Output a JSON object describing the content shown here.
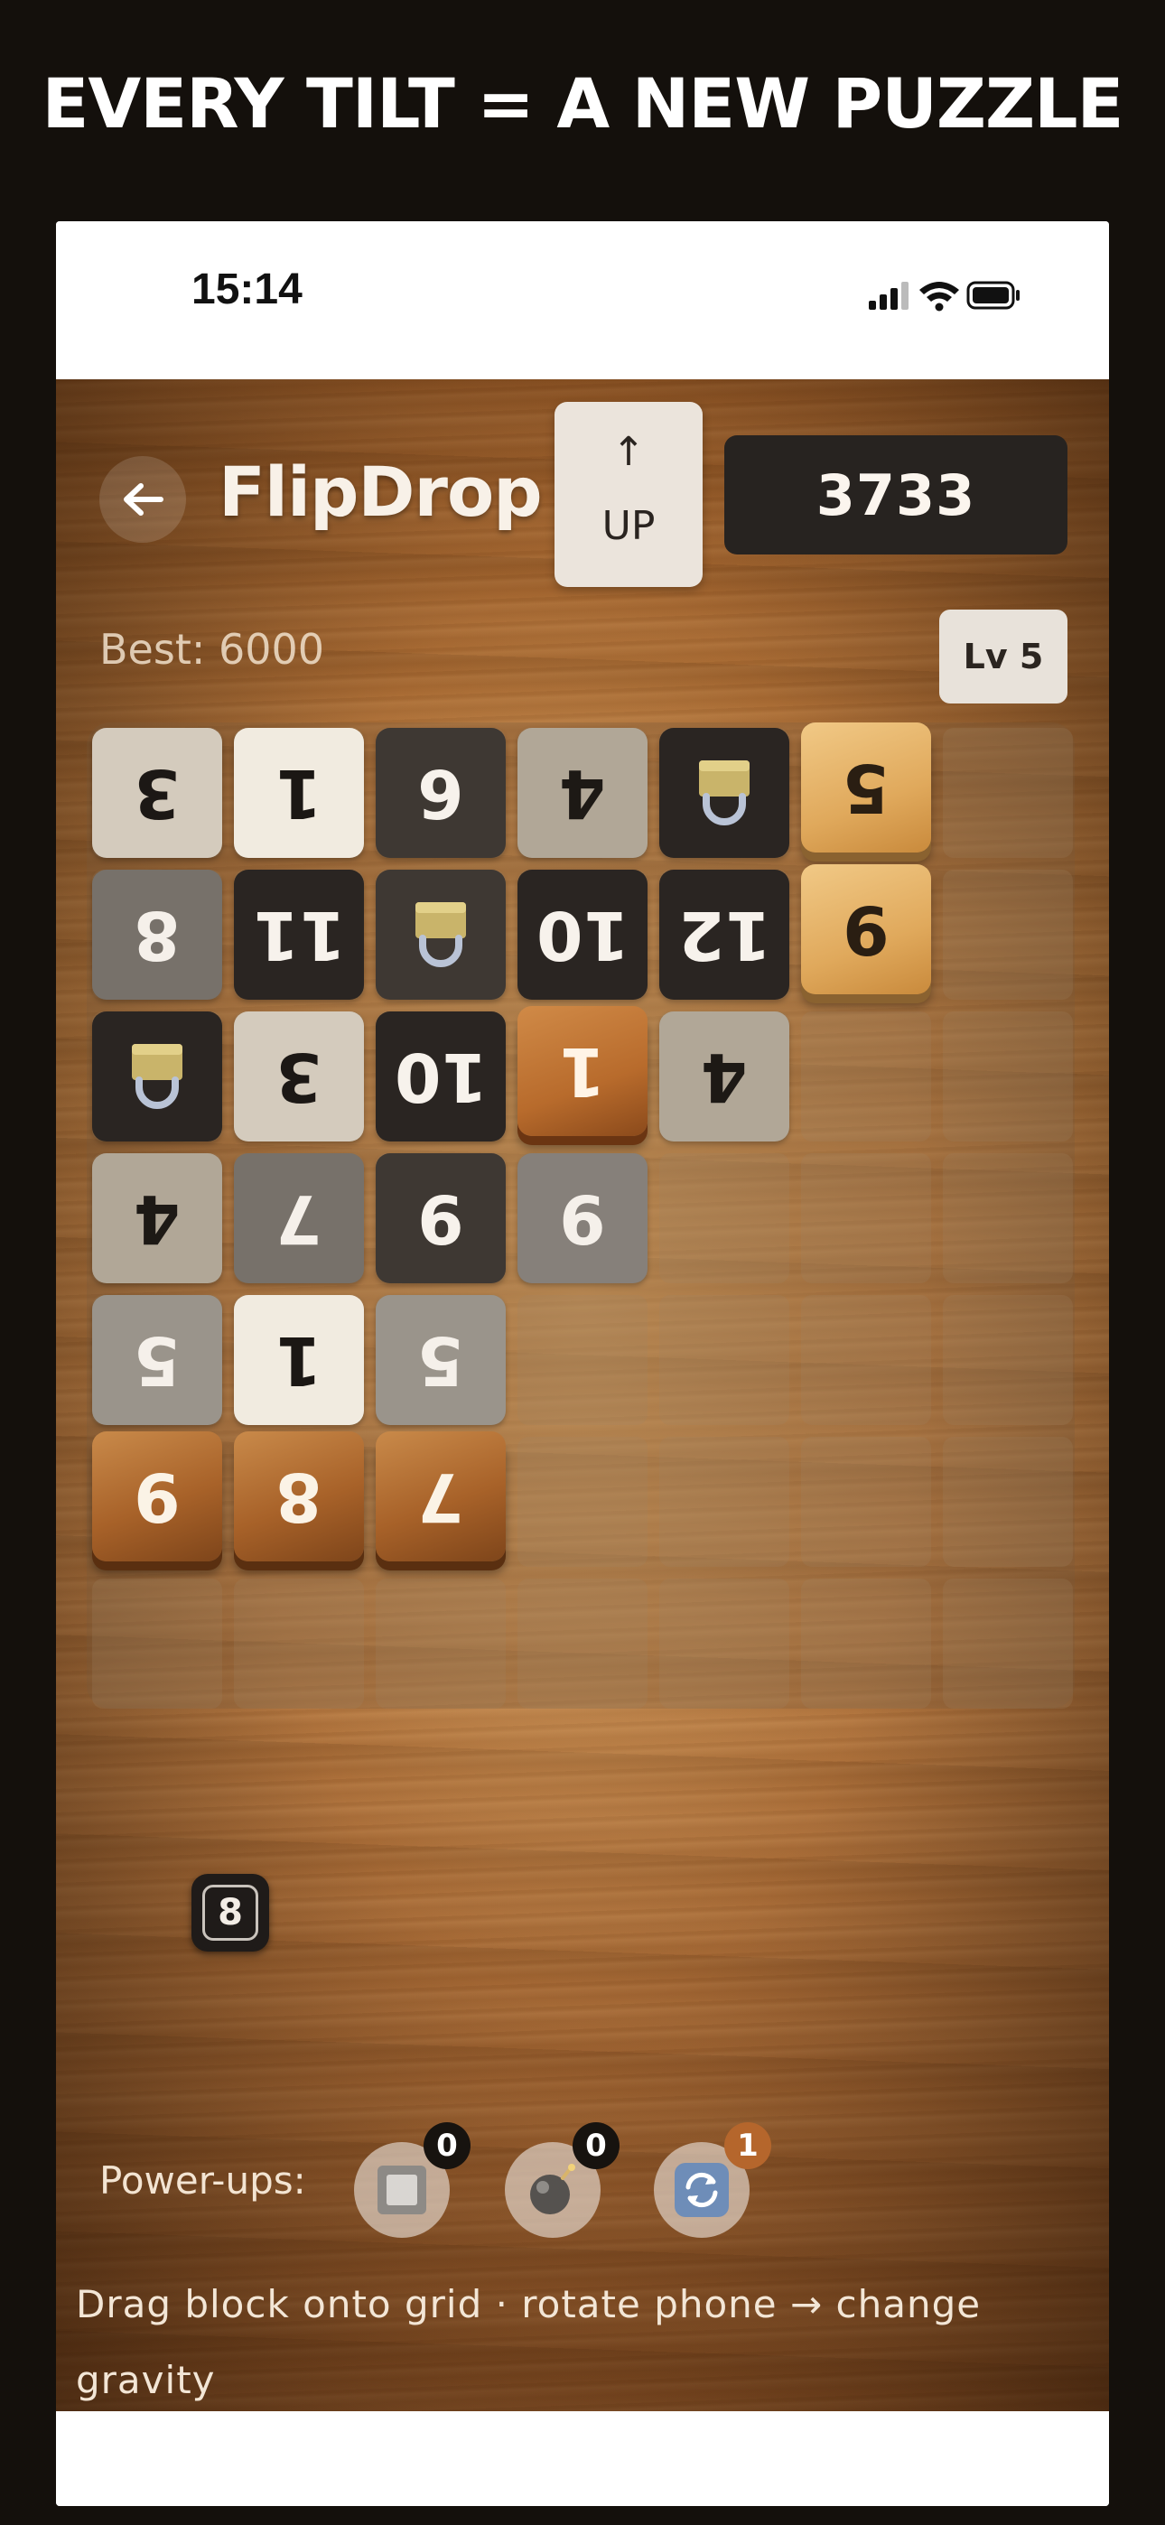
{
  "banner": {
    "headline": "EVERY TILT = A NEW PUZZLE"
  },
  "status_bar": {
    "time": "15:14"
  },
  "header": {
    "title": "FlipDrop",
    "gravity_arrow": "↑",
    "gravity_label": "UP",
    "score": "3733",
    "best": "Best: 6000",
    "level": "Lv 5"
  },
  "grid": {
    "columns": 7,
    "rows": 7,
    "tiles": [
      {
        "row": 0,
        "col": 0,
        "label": "3",
        "style": "light"
      },
      {
        "row": 0,
        "col": 1,
        "label": "1",
        "style": "white"
      },
      {
        "row": 0,
        "col": 2,
        "label": "6",
        "style": "dark"
      },
      {
        "row": 0,
        "col": 3,
        "label": "4",
        "style": "tan"
      },
      {
        "row": 0,
        "col": 4,
        "label": "",
        "style": "darkest",
        "icon": "padlock-icon"
      },
      {
        "row": 0,
        "col": 5,
        "label": "5",
        "style": "gold"
      },
      {
        "row": 1,
        "col": 0,
        "label": "8",
        "style": "mid"
      },
      {
        "row": 1,
        "col": 1,
        "label": "11",
        "style": "darkest"
      },
      {
        "row": 1,
        "col": 2,
        "label": "",
        "style": "dark",
        "icon": "padlock-icon"
      },
      {
        "row": 1,
        "col": 3,
        "label": "10",
        "style": "darkest"
      },
      {
        "row": 1,
        "col": 4,
        "label": "12",
        "style": "darkest"
      },
      {
        "row": 1,
        "col": 5,
        "label": "9",
        "style": "gold"
      },
      {
        "row": 2,
        "col": 0,
        "label": "",
        "style": "darkest",
        "icon": "padlock-icon"
      },
      {
        "row": 2,
        "col": 1,
        "label": "3",
        "style": "light"
      },
      {
        "row": 2,
        "col": 2,
        "label": "10",
        "style": "darkest"
      },
      {
        "row": 2,
        "col": 3,
        "label": "1",
        "style": "ember"
      },
      {
        "row": 2,
        "col": 4,
        "label": "4",
        "style": "tan"
      },
      {
        "row": 3,
        "col": 0,
        "label": "4",
        "style": "tan"
      },
      {
        "row": 3,
        "col": 1,
        "label": "7",
        "style": "mid"
      },
      {
        "row": 3,
        "col": 2,
        "label": "9",
        "style": "dark"
      },
      {
        "row": 3,
        "col": 3,
        "label": "9",
        "style": "midgrey"
      },
      {
        "row": 4,
        "col": 0,
        "label": "5",
        "style": "midlight"
      },
      {
        "row": 4,
        "col": 1,
        "label": "1",
        "style": "white"
      },
      {
        "row": 4,
        "col": 2,
        "label": "5",
        "style": "midlight"
      },
      {
        "row": 5,
        "col": 0,
        "label": "9",
        "style": "wood"
      },
      {
        "row": 5,
        "col": 1,
        "label": "8",
        "style": "wood"
      },
      {
        "row": 5,
        "col": 2,
        "label": "7",
        "style": "wood"
      }
    ]
  },
  "next_block": {
    "value": "8"
  },
  "powerups": {
    "label": "Power-ups:",
    "items": [
      {
        "name": "block",
        "icon": "block-icon",
        "count": "0"
      },
      {
        "name": "bomb",
        "icon": "bomb-icon",
        "count": "0"
      },
      {
        "name": "rotate",
        "icon": "rotate-icon",
        "count": "1"
      }
    ]
  },
  "hint": "Drag block onto grid · rotate phone → change gravity"
}
